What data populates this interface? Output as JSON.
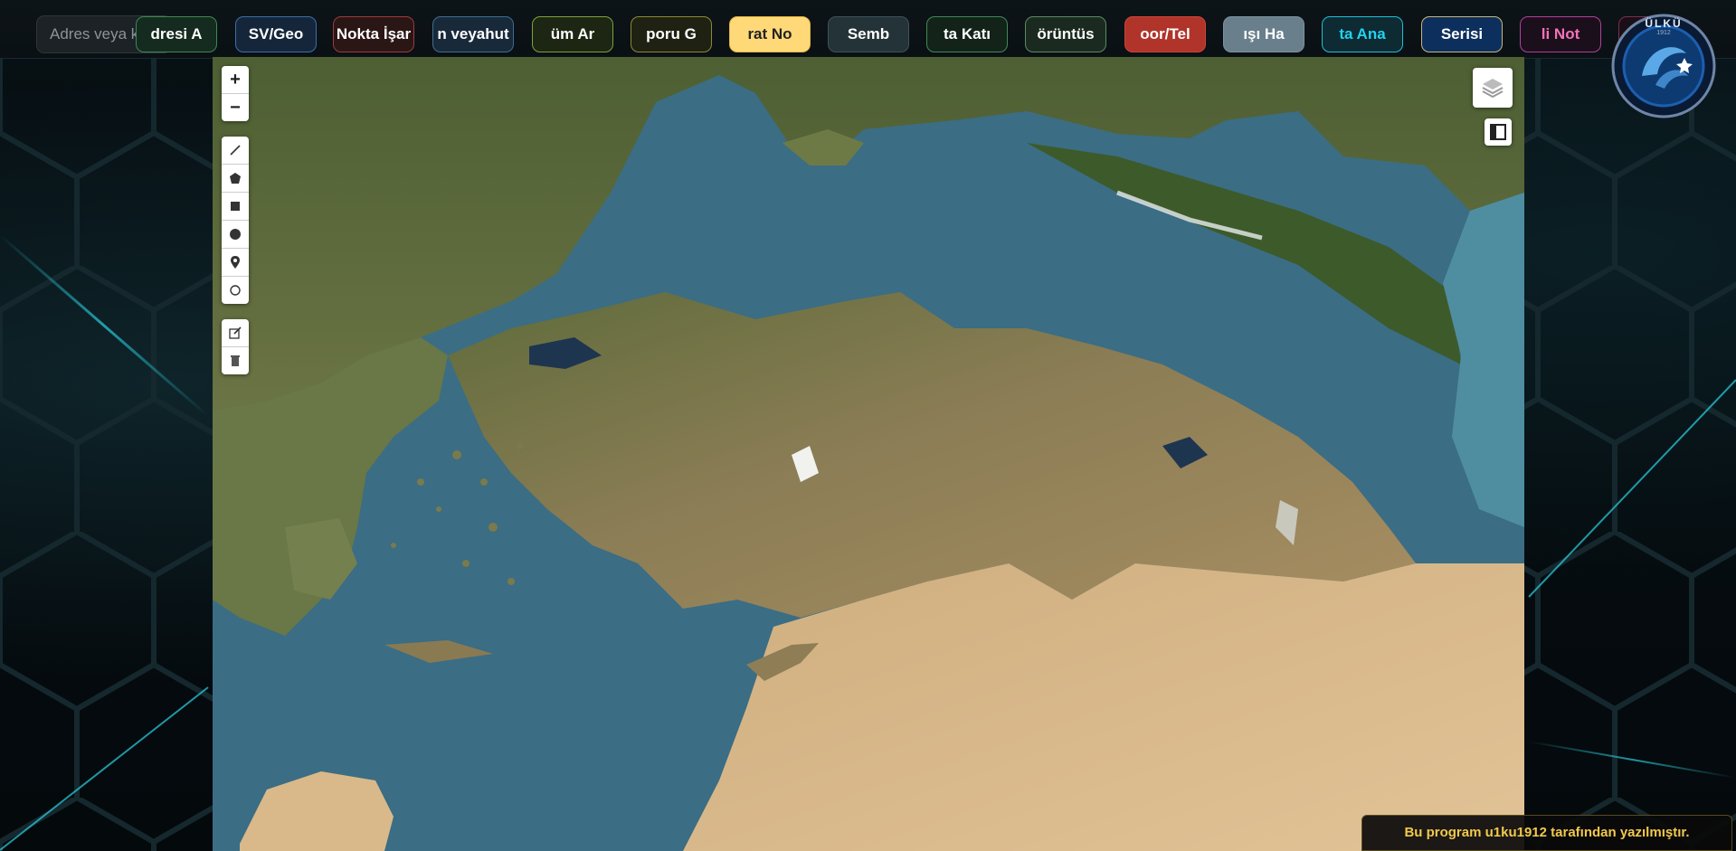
{
  "search": {
    "placeholder": "Adres veya k"
  },
  "toolbar": [
    {
      "label": "dresi A",
      "bg": "#162b1f",
      "border": "#3c8a52",
      "color": "#ffffff"
    },
    {
      "label": "SV/Geo",
      "bg": "#15263b",
      "border": "#3b6fa8",
      "color": "#ffffff"
    },
    {
      "label": "Nokta İşar",
      "bg": "#2b1616",
      "border": "#9c3b3b",
      "color": "#ffffff"
    },
    {
      "label": "n veyahut",
      "bg": "#18293a",
      "border": "#3f6e8f",
      "color": "#ffffff"
    },
    {
      "label": "üm Ar",
      "bg": "#1d2613",
      "border": "#7ea23d",
      "color": "#ffffff"
    },
    {
      "label": "poru G",
      "bg": "#1f2112",
      "border": "#8a8a35",
      "color": "#ffffff"
    },
    {
      "label": "rat No",
      "bg": "#ffd978",
      "border": "#e0b548",
      "color": "#222222"
    },
    {
      "label": "Semb",
      "bg": "#233338",
      "border": "#3e5259",
      "color": "#ffffff"
    },
    {
      "label": "ta Katı",
      "bg": "#132319",
      "border": "#3f8a57",
      "color": "#ffffff"
    },
    {
      "label": "örüntüs",
      "bg": "#1b2a20",
      "border": "#5b8a62",
      "color": "#ffffff"
    },
    {
      "label": "oor/Tel",
      "bg": "#b0342a",
      "border": "#c9463b",
      "color": "#ffffff"
    },
    {
      "label": "ışı Ha",
      "bg": "#6a7f8c",
      "border": "#7d929e",
      "color": "#ffffff"
    },
    {
      "label": "ta Ana",
      "bg": "#0e2a33",
      "border": "#1fbfd6",
      "color": "#22d3ee"
    },
    {
      "label": "Serisi",
      "bg": "#0d2f5e",
      "border": "#c9b77a",
      "color": "#ffffff"
    },
    {
      "label": "li Not",
      "bg": "#1c0f1c",
      "border": "#b0409a",
      "color": "#f472b6"
    },
    {
      "label": "",
      "bg": "#1a0f16",
      "border": "#7a2f4f",
      "color": "#ffffff"
    }
  ],
  "map_controls": {
    "zoom_in": "+",
    "zoom_out": "−"
  },
  "draw_tools": [
    "polyline-icon",
    "polygon-icon",
    "rectangle-icon",
    "circle-icon",
    "marker-icon",
    "circle-marker-icon"
  ],
  "edit_tools": [
    "edit-icon",
    "delete-icon"
  ],
  "logo": {
    "text": "ÜLKÜ",
    "sub": "1912"
  },
  "credit": {
    "text": "Bu program u1ku1912 tarafından yazılmıştır."
  },
  "colors": {
    "sea": "#3e6f86",
    "land": "#8a7a52",
    "desert": "#d9b98a",
    "accent": "#f2c94c"
  }
}
